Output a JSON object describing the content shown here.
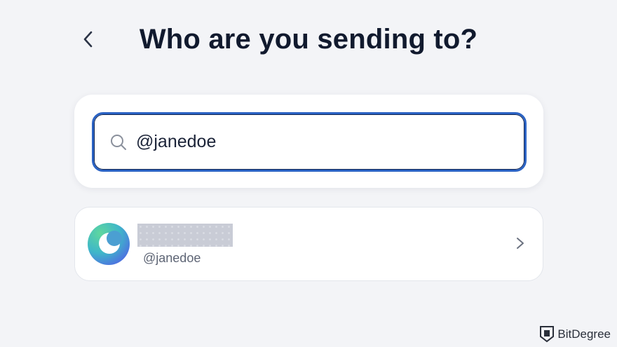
{
  "header": {
    "title": "Who are you sending to?",
    "back_icon": "chevron-left-icon"
  },
  "search": {
    "value": "@janedoe",
    "icon": "search-icon",
    "accent_color": "#2b63c4"
  },
  "results": [
    {
      "name_redacted": true,
      "handle": "@janedoe",
      "chevron_icon": "chevron-right-icon"
    }
  ],
  "watermark": {
    "text": "BitDegree"
  }
}
